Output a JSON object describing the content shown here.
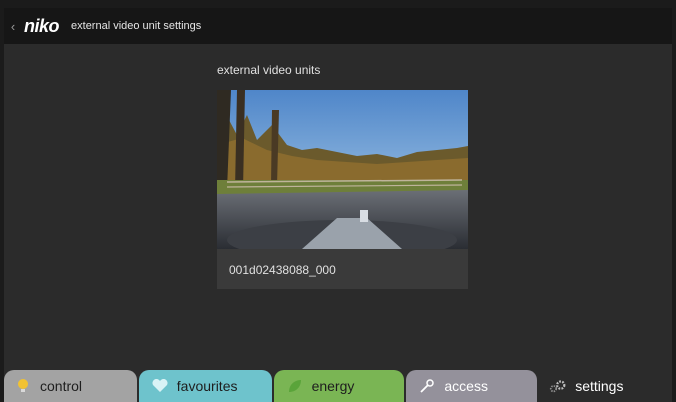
{
  "header": {
    "back_icon": "chevron-left-icon",
    "logo": "niko",
    "title": "external video unit settings"
  },
  "main": {
    "section_label": "external video units",
    "video_units": [
      {
        "name": "001d02438088_000",
        "thumbnail": "outdoor-parking-lot-camera-view"
      }
    ]
  },
  "tabs": [
    {
      "label": "control",
      "icon": "lightbulb-icon",
      "color": "#a3a3a3"
    },
    {
      "label": "favourites",
      "icon": "heart-icon",
      "color": "#6ec3cc"
    },
    {
      "label": "energy",
      "icon": "leaf-icon",
      "color": "#7ab554"
    },
    {
      "label": "access",
      "icon": "key-icon",
      "color": "#94919b"
    },
    {
      "label": "settings",
      "icon": "gears-icon",
      "color": "#2b2b2b",
      "active": true
    }
  ]
}
